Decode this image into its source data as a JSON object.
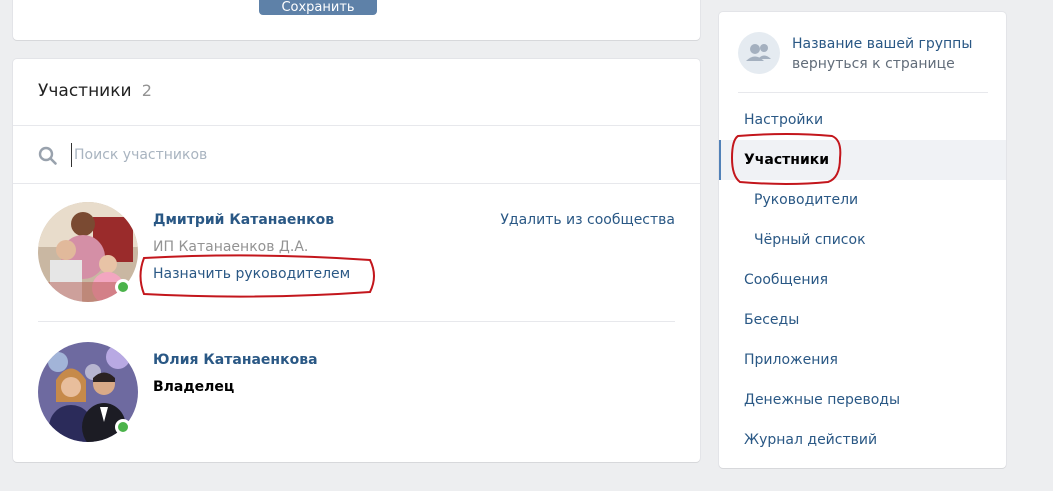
{
  "top": {
    "save_label": "Сохранить"
  },
  "members": {
    "title": "Участники",
    "count": "2",
    "search_placeholder": "Поиск участников",
    "list": [
      {
        "name": "Дмитрий Катанаенков",
        "subtitle": "ИП Катанаенков Д.А.",
        "action": "Назначить руководителем",
        "remove": "Удалить из сообщества",
        "online": true
      },
      {
        "name": "Юлия Катанаенкова",
        "role": "Владелец",
        "online": true
      }
    ]
  },
  "sidebar": {
    "group_name": "Название вашей группы",
    "back_link": "вернуться к странице",
    "items": [
      {
        "label": "Настройки",
        "active": false
      },
      {
        "label": "Участники",
        "active": true
      },
      {
        "label": "Руководители",
        "active": false,
        "sub": true
      },
      {
        "label": "Чёрный список",
        "active": false,
        "sub": true
      },
      {
        "label": "Сообщения",
        "active": false
      },
      {
        "label": "Беседы",
        "active": false
      },
      {
        "label": "Приложения",
        "active": false
      },
      {
        "label": "Денежные переводы",
        "active": false
      },
      {
        "label": "Журнал действий",
        "active": false
      }
    ]
  },
  "colors": {
    "link": "#2a5885",
    "accent": "#5181b8",
    "online": "#4bb34b",
    "highlight": "#c3161c"
  },
  "icons": {
    "search": "search-icon",
    "group": "group-icon"
  }
}
